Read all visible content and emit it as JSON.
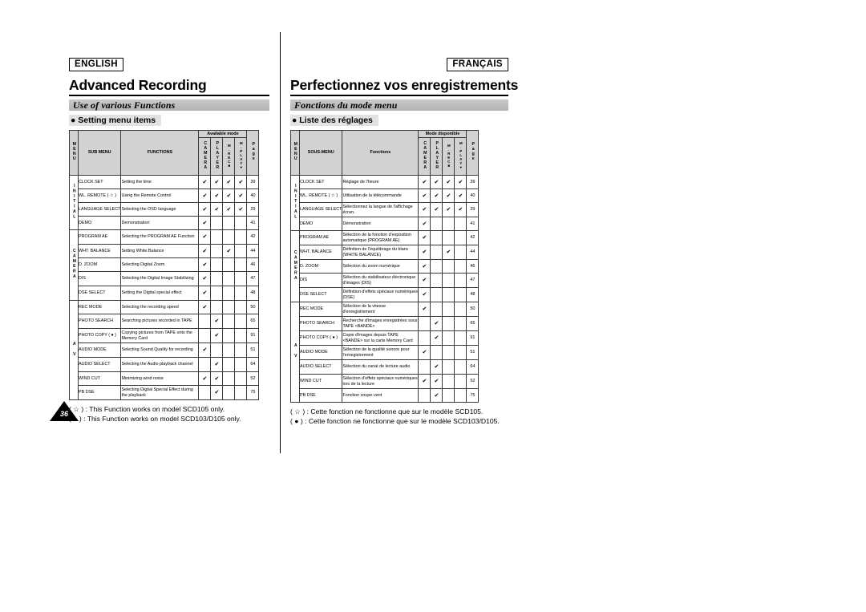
{
  "english": {
    "language_badge": "ENGLISH",
    "title": "Advanced Recording",
    "section": "Use of various Functions",
    "bullet": "● Setting menu items",
    "table": {
      "available_mode_header": "Available mode",
      "columns": {
        "menu": "MENU",
        "sub_menu": "SUB MENU",
        "functions": "FUNCTIONS",
        "camera": "CAMERA",
        "player": "PLAYER",
        "mrec": "M.REC■",
        "mplay": "M.PLAY●",
        "page": "Page"
      },
      "groups": [
        {
          "menu": "INITIAL",
          "rows": [
            {
              "sub": "CLOCK SET",
              "fn": "Setting the time",
              "camera": true,
              "player": true,
              "mrec": true,
              "mplay": true,
              "page": "39"
            },
            {
              "sub": "WL. REMOTE ( ☆ )",
              "fn": "Using the Remote Control",
              "camera": true,
              "player": true,
              "mrec": true,
              "mplay": true,
              "page": "40"
            },
            {
              "sub": "LANGUAGE SELECT",
              "fn": "Selecting the OSD language",
              "camera": true,
              "player": true,
              "mrec": true,
              "mplay": true,
              "page": "29"
            },
            {
              "sub": "DEMO",
              "fn": "Demonstration",
              "camera": true,
              "player": false,
              "mrec": false,
              "mplay": false,
              "page": "41"
            }
          ]
        },
        {
          "menu": "CAMERA",
          "rows": [
            {
              "sub": "PROGRAM AE",
              "fn": "Selecting the PROGRAM AE Function",
              "camera": true,
              "player": false,
              "mrec": false,
              "mplay": false,
              "page": "42"
            },
            {
              "sub": "WHT. BALANCE",
              "fn": "Setting White Balance",
              "camera": true,
              "player": false,
              "mrec": true,
              "mplay": false,
              "page": "44"
            },
            {
              "sub": "D. ZOOM",
              "fn": "Selecting Digital Zoom",
              "camera": true,
              "player": false,
              "mrec": false,
              "mplay": false,
              "page": "46"
            },
            {
              "sub": "DIS",
              "fn": "Selecting the Digital Image Stabilizing",
              "camera": true,
              "player": false,
              "mrec": false,
              "mplay": false,
              "page": "47"
            },
            {
              "sub": "DSE SELECT",
              "fn": "Setting the Digital special effect",
              "camera": true,
              "player": false,
              "mrec": false,
              "mplay": false,
              "page": "48"
            }
          ]
        },
        {
          "menu": "A V",
          "rows": [
            {
              "sub": "REC MODE",
              "fn": "Selecting the recording speed",
              "camera": true,
              "player": false,
              "mrec": false,
              "mplay": false,
              "page": "50"
            },
            {
              "sub": "PHOTO SEARCH",
              "fn": "Searching pictures recorded in TAPE",
              "camera": false,
              "player": true,
              "mrec": false,
              "mplay": false,
              "page": "65"
            },
            {
              "sub": "PHOTO COPY ( ● )",
              "fn": "Copying pictures from TAPE onto the Memory Card",
              "camera": false,
              "player": true,
              "mrec": false,
              "mplay": false,
              "page": "91"
            },
            {
              "sub": "AUDIO MODE",
              "fn": "Selecting Sound Quality for recording",
              "camera": true,
              "player": false,
              "mrec": false,
              "mplay": false,
              "page": "51"
            },
            {
              "sub": "AUDIO SELECT",
              "fn": "Selecting the Audio playback channel",
              "camera": false,
              "player": true,
              "mrec": false,
              "mplay": false,
              "page": "64"
            },
            {
              "sub": "WIND CUT",
              "fn": "Minimizing wind noise",
              "camera": true,
              "player": true,
              "mrec": false,
              "mplay": false,
              "page": "52"
            },
            {
              "sub": "PB DSE",
              "fn": "Selecting Digital Special Effect during the playback",
              "camera": false,
              "player": true,
              "mrec": false,
              "mplay": false,
              "page": "75"
            }
          ]
        }
      ]
    },
    "footnotes": [
      "( ☆ ) : This Function works on model SCD105 only.",
      "( ● ) : This Function works on model SCD103/D105 only."
    ]
  },
  "french": {
    "language_badge": "FRANÇAIS",
    "title": "Perfectionnez vos enregistrements",
    "section": "Fonctions du mode menu",
    "bullet": "● Liste des réglages",
    "table": {
      "available_mode_header": "Mode disponible",
      "columns": {
        "menu": "MENU",
        "sub_menu": "SOUS-MENU",
        "functions": "Fonctions",
        "camera": "CAMERA",
        "player": "PLAYER",
        "mrec": "M.REC■",
        "mplay": "M.PLAY●",
        "page": "Page"
      },
      "groups": [
        {
          "menu": "INITIAL",
          "rows": [
            {
              "sub": "CLOCK SET",
              "fn": "Réglage de l'heure",
              "camera": true,
              "player": true,
              "mrec": true,
              "mplay": true,
              "page": "39"
            },
            {
              "sub": "WL. REMOTE ( ☆ )",
              "fn": "Utilisation de la télécommande",
              "camera": true,
              "player": true,
              "mrec": true,
              "mplay": true,
              "page": "40"
            },
            {
              "sub": "LANGUAGE SELECT",
              "fn": "Sélectionnez la langue de l'affichage écran.",
              "camera": true,
              "player": true,
              "mrec": true,
              "mplay": true,
              "page": "29"
            },
            {
              "sub": "DEMO",
              "fn": "Démonstration",
              "camera": true,
              "player": false,
              "mrec": false,
              "mplay": false,
              "page": "41"
            }
          ]
        },
        {
          "menu": "CAMERA",
          "rows": [
            {
              "sub": "PROGRAM AE",
              "fn": "Sélection de la fonction d'exposition automatique (PROGRAM AE)",
              "camera": true,
              "player": false,
              "mrec": false,
              "mplay": false,
              "page": "42"
            },
            {
              "sub": "WHT. BALANCE",
              "fn": "Définition de l'équilibrage du blanc (WHITE BALANCE)",
              "camera": true,
              "player": false,
              "mrec": true,
              "mplay": false,
              "page": "44"
            },
            {
              "sub": "D. ZOOM",
              "fn": "Sélection du zoom numérique",
              "camera": true,
              "player": false,
              "mrec": false,
              "mplay": false,
              "page": "46"
            },
            {
              "sub": "DIS",
              "fn": "Sélection du stabilisateur électronique d'images (DIS)",
              "camera": true,
              "player": false,
              "mrec": false,
              "mplay": false,
              "page": "47"
            },
            {
              "sub": "DSE SELECT",
              "fn": "Définition d'effets spéciaux numériques (DSE)",
              "camera": true,
              "player": false,
              "mrec": false,
              "mplay": false,
              "page": "48"
            }
          ]
        },
        {
          "menu": "A V",
          "rows": [
            {
              "sub": "REC MODE",
              "fn": "Sélection de la vitesse d'enregistrement",
              "camera": true,
              "player": false,
              "mrec": false,
              "mplay": false,
              "page": "50"
            },
            {
              "sub": "PHOTO SEARCH",
              "fn": "Recherche d'images enregistrées sous TAPE <BANDE>",
              "camera": false,
              "player": true,
              "mrec": false,
              "mplay": false,
              "page": "65"
            },
            {
              "sub": "PHOTO COPY ( ● )",
              "fn": "Copie d'images depuis TAPE <BANDE> sur la carte Memory Card",
              "camera": false,
              "player": true,
              "mrec": false,
              "mplay": false,
              "page": "91"
            },
            {
              "sub": "AUDIO MODE",
              "fn": "Sélection de la qualité sonore pour l'enregistrement",
              "camera": true,
              "player": false,
              "mrec": false,
              "mplay": false,
              "page": "51"
            },
            {
              "sub": "AUDIO SELECT",
              "fn": "Sélection du canal de lecture audio",
              "camera": false,
              "player": true,
              "mrec": false,
              "mplay": false,
              "page": "64"
            },
            {
              "sub": "WIND CUT",
              "fn": "Sélection d'effets spéciaux numériques lors de la lecture",
              "camera": true,
              "player": true,
              "mrec": false,
              "mplay": false,
              "page": "52"
            },
            {
              "sub": "PB DSE",
              "fn": "Fonction coupe-vent",
              "camera": false,
              "player": true,
              "mrec": false,
              "mplay": false,
              "page": "75"
            }
          ]
        }
      ]
    },
    "footnotes": [
      "( ☆ ) : Cette fonction ne fonctionne que sur le modèle SCD105.",
      "( ● ) : Cette fonction ne fonctionne que sur le modèle SCD103/D105."
    ]
  },
  "page_number": "36",
  "check_glyph": "✔"
}
